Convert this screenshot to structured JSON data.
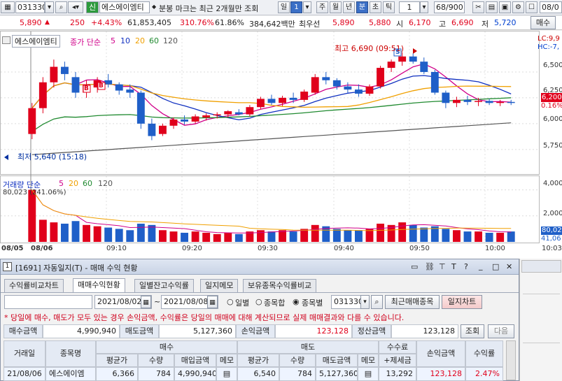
{
  "toolbar": {
    "code": "031330",
    "badge": "신",
    "stock_name": "에스에이엠티",
    "notice": "분봉 마크는 최근 2개월만 조회",
    "period_label": "일",
    "period_value": "1",
    "tabs": [
      "주",
      "월",
      "년",
      "분",
      "초",
      "틱"
    ],
    "active_tab": "분",
    "interval": "1",
    "count": "68/900",
    "date_cut": "08/0"
  },
  "quote": {
    "price": "5,890",
    "change": "250",
    "change_pct": "+4.43%",
    "volume": "61,853,405",
    "vol_ratio": "310.76%",
    "turnover": "61.86%",
    "amount": "384,642백만",
    "priority_label": "최우선",
    "ask": "5,890",
    "bid": "5,880",
    "open_label": "시",
    "open": "6,170",
    "high_label": "고",
    "high": "6,690",
    "low_label": "저",
    "low": "5,720",
    "sell_label": "매수"
  },
  "chart": {
    "legend_name": "에스에이엠티",
    "legend_ma": "종가 단순",
    "ma_periods": [
      "5",
      "10",
      "20",
      "60",
      "120"
    ],
    "ma_colors": [
      "#d0008a",
      "#1030c0",
      "#f0a000",
      "#208a30",
      "#555555"
    ],
    "high_marker": "최고 6,690 (09:51)",
    "low_marker": "최저 5,640 (15:18)",
    "lc_label": "LC:9,9",
    "hc_label": "HC:-7,",
    "current_price": "6,200",
    "current_pct": "0.16%",
    "price_ticks": [
      "6,500",
      "6,250",
      "6,000",
      "5,750"
    ],
    "volume_legend": "거래량 단순",
    "volume_ma": [
      "5",
      "20",
      "60",
      "120"
    ],
    "volume_readout": "80,023 (241.06%)",
    "volume_ticks": [
      "4,000",
      "2,000"
    ],
    "volume_current": "80,02",
    "volume_current2": "41,06",
    "time_ticks": [
      "08/05",
      "08/06",
      "09:10",
      "09:20",
      "09:30",
      "09:40",
      "09:50",
      "10:00",
      "10:03"
    ],
    "mark_b": "B",
    "mark_s": "S"
  },
  "chart_data": {
    "type": "candlestick",
    "title": "",
    "candles": [
      [
        5900,
        6200,
        5850,
        6150
      ],
      [
        6150,
        6450,
        6100,
        6400
      ],
      [
        6400,
        6620,
        6350,
        6550
      ],
      [
        6550,
        6600,
        6420,
        6480
      ],
      [
        6450,
        6500,
        6250,
        6300
      ],
      [
        6300,
        6420,
        6250,
        6380
      ],
      [
        6350,
        6450,
        6300,
        6420
      ],
      [
        6420,
        6480,
        6350,
        6380
      ],
      [
        6380,
        6400,
        6280,
        6320
      ],
      [
        6330,
        6380,
        6250,
        6300
      ],
      [
        6300,
        6320,
        5950,
        6000
      ],
      [
        6000,
        6050,
        5840,
        5880
      ],
      [
        5900,
        6000,
        5880,
        5980
      ],
      [
        5980,
        6060,
        5950,
        6040
      ],
      [
        6040,
        6080,
        5990,
        6020
      ],
      [
        6020,
        6090,
        6000,
        6070
      ],
      [
        6060,
        6100,
        6030,
        6080
      ],
      [
        6080,
        6110,
        6050,
        6090
      ],
      [
        6090,
        6130,
        6060,
        6120
      ],
      [
        6110,
        6140,
        6080,
        6090
      ],
      [
        6090,
        6180,
        6070,
        6160
      ],
      [
        6160,
        6260,
        6140,
        6240
      ],
      [
        6240,
        6280,
        6180,
        6200
      ],
      [
        6200,
        6270,
        6170,
        6250
      ],
      [
        6250,
        6300,
        6200,
        6230
      ],
      [
        6230,
        6330,
        6210,
        6310
      ],
      [
        6300,
        6480,
        6280,
        6450
      ],
      [
        6450,
        6500,
        6380,
        6420
      ],
      [
        6420,
        6440,
        6330,
        6360
      ],
      [
        6360,
        6400,
        6300,
        6330
      ],
      [
        6330,
        6380,
        6260,
        6290
      ],
      [
        6290,
        6380,
        6270,
        6360
      ],
      [
        6360,
        6560,
        6340,
        6540
      ],
      [
        6540,
        6620,
        6500,
        6600
      ],
      [
        6600,
        6690,
        6560,
        6650
      ],
      [
        6650,
        6680,
        6580,
        6600
      ],
      [
        6600,
        6640,
        6480,
        6500
      ],
      [
        6500,
        6520,
        6280,
        6300
      ],
      [
        6300,
        6320,
        6150,
        6200
      ],
      [
        6200,
        6260,
        6160,
        6230
      ],
      [
        6230,
        6270,
        6180,
        6210
      ],
      [
        6210,
        6250,
        6170,
        6220
      ],
      [
        6220,
        6240,
        6180,
        6200
      ],
      [
        6200,
        6230,
        6170,
        6210
      ],
      [
        6210,
        6230,
        6180,
        6200
      ]
    ],
    "volume": [
      4000,
      1700,
      1500,
      1400,
      1600,
      1300,
      1200,
      1100,
      1000,
      900,
      1400,
      1300,
      900,
      800,
      700,
      800,
      700,
      600,
      700,
      600,
      800,
      900,
      800,
      900,
      800,
      1000,
      1300,
      1200,
      1000,
      900,
      900,
      1000,
      1400,
      1300,
      1500,
      1300,
      1100,
      1200,
      1000,
      900,
      800,
      800,
      700,
      700,
      800
    ],
    "ylim": [
      5600,
      6750
    ],
    "volume_ylim": [
      0,
      4300
    ]
  },
  "panel": {
    "number": "1",
    "title": "[1691] 자동일지(T) - 매매 수익 현황",
    "tabs": [
      "수익률비교차트",
      "매매수익현황",
      "일별잔고수익률",
      "일지메모",
      "보유종목수익률비교"
    ],
    "active_tab": "매매수익현황",
    "account": "",
    "date_from": "2021/08/02",
    "date_to": "2021/08/08",
    "radio_daily": "일별",
    "radio_combined": "종목합",
    "radio_by_item": "종목별",
    "item_code": "031330",
    "recent_button": "최근매매종목",
    "journal_button": "일지차트",
    "notice": "* 당일에 매수, 매도가 모두 있는 경우 손익금액, 수익률은 당일의 매매에 대해 계산되므로 실제 매매결과와 다를 수 있습니다.",
    "summary": {
      "buy_label": "매수금액",
      "buy_value": "4,990,940",
      "sell_label": "매도금액",
      "sell_value": "5,127,360",
      "pl_label": "손익금액",
      "pl_value": "123,128",
      "settle_label": "정산금액",
      "settle_value": "123,128",
      "query_button": "조회",
      "next_button": "다음"
    },
    "headers": {
      "date": "거래일",
      "item": "종목명",
      "buy": "매수",
      "sell": "매도",
      "fee": "수수료",
      "fee2": "+제세금",
      "pl": "손익금액",
      "rate": "수익률",
      "avg": "평균가",
      "qty": "수량",
      "buy_amt": "매입금액",
      "memo": "메모",
      "sell_amt": "매도금액"
    },
    "row": {
      "date": "21/08/06",
      "item": "에스에이엠",
      "buy_avg": "6,366",
      "buy_qty": "784",
      "buy_amt": "4,990,940",
      "sell_avg": "6,540",
      "sell_qty": "784",
      "sell_amt": "5,127,360",
      "fee": "13,292",
      "pl": "123,128",
      "rate": "2.47%"
    }
  }
}
